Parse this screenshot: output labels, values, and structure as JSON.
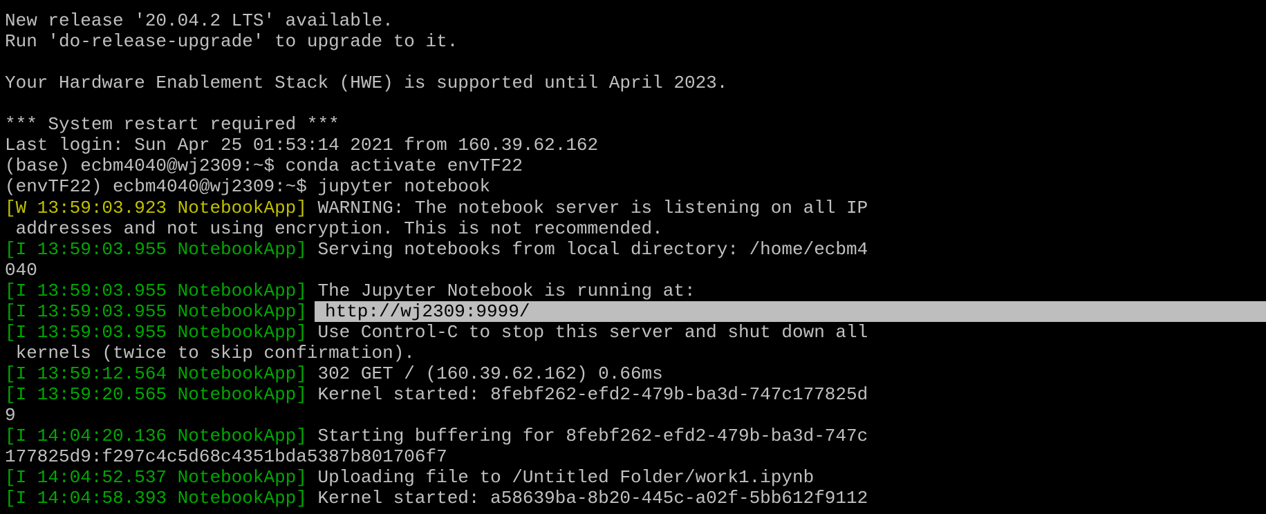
{
  "terminal": {
    "colors": {
      "background": "#000000",
      "text": "#c0c0c0",
      "warning_prefix": "#c0c000",
      "info_prefix": "#00a800",
      "selection_bg": "#bebebe",
      "selection_text": "#000000"
    },
    "motd": {
      "release": "New release '20.04.2 LTS' available.",
      "upgrade": "Run 'do-release-upgrade' to upgrade to it.",
      "hwe": "Your Hardware Enablement Stack (HWE) is supported until April 2023.",
      "restart": "*** System restart required ***",
      "last_login": "Last login: Sun Apr 25 01:53:14 2021 from 160.39.62.162"
    },
    "commands": [
      "(base) ecbm4040@wj2309:~$ conda activate envTF22",
      "(envTF22) ecbm4040@wj2309:~$ jupyter notebook"
    ],
    "log": [
      {
        "prefix": "[W 13:59:03.923 NotebookApp]",
        "message": " WARNING: The notebook server is listening on all IP"
      },
      {
        "continuation": " addresses and not using encryption. This is not recommended."
      },
      {
        "prefix": "[I 13:59:03.955 NotebookApp]",
        "message": " Serving notebooks from local directory: /home/ecbm4"
      },
      {
        "continuation": "040"
      },
      {
        "prefix": "[I 13:59:03.955 NotebookApp]",
        "message": " The Jupyter Notebook is running at:"
      },
      {
        "prefix": "[I 13:59:03.955 NotebookApp]",
        "message": "http://wj2309:9999/"
      },
      {
        "prefix": "[I 13:59:03.955 NotebookApp]",
        "message": " Use Control-C to stop this server and shut down all"
      },
      {
        "continuation": " kernels (twice to skip confirmation)."
      },
      {
        "prefix": "[I 13:59:12.564 NotebookApp]",
        "message": " 302 GET / (160.39.62.162) 0.66ms"
      },
      {
        "prefix": "[I 13:59:20.565 NotebookApp]",
        "message": " Kernel started: 8febf262-efd2-479b-ba3d-747c177825d"
      },
      {
        "continuation": "9"
      },
      {
        "prefix": "[I 14:04:20.136 NotebookApp]",
        "message": " Starting buffering for 8febf262-efd2-479b-ba3d-747c"
      },
      {
        "continuation": "177825d9:f297c4c5d68c4351bda5387b801706f7"
      },
      {
        "prefix": "[I 14:04:52.537 NotebookApp]",
        "message": " Uploading file to /Untitled Folder/work1.ipynb"
      },
      {
        "prefix": "[I 14:04:58.393 NotebookApp]",
        "message": " Kernel started: a58639ba-8b20-445c-a02f-5bb612f9112"
      }
    ]
  }
}
